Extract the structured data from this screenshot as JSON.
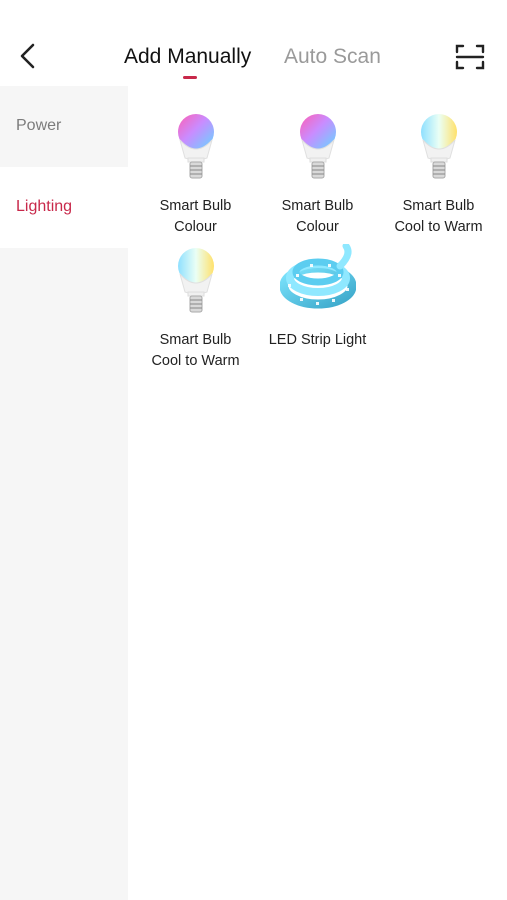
{
  "header": {
    "tabs": [
      {
        "label": "Add Manually",
        "active": true
      },
      {
        "label": "Auto Scan",
        "active": false
      }
    ],
    "back_icon": "chevron-left-icon",
    "scan_icon": "scan-icon"
  },
  "sidebar": {
    "items": [
      {
        "label": "Power",
        "active": false
      },
      {
        "label": "Lighting",
        "active": true
      }
    ]
  },
  "devices": [
    {
      "line1": "Smart Bulb",
      "line2": "Colour",
      "icon": "rgb-bulb-icon"
    },
    {
      "line1": "Smart Bulb",
      "line2": "Colour",
      "icon": "rgb-bulb-icon"
    },
    {
      "line1": "Smart Bulb",
      "line2": "Cool to Warm",
      "icon": "cct-bulb-icon"
    },
    {
      "line1": "Smart Bulb",
      "line2": "Cool to Warm",
      "icon": "cct-bulb-icon"
    },
    {
      "line1": "LED Strip Light",
      "line2": "",
      "icon": "led-strip-icon"
    }
  ],
  "colors": {
    "accent": "#c8284a",
    "sidebar_bg": "#f6f6f6",
    "inactive_text": "#9a9a9a"
  }
}
